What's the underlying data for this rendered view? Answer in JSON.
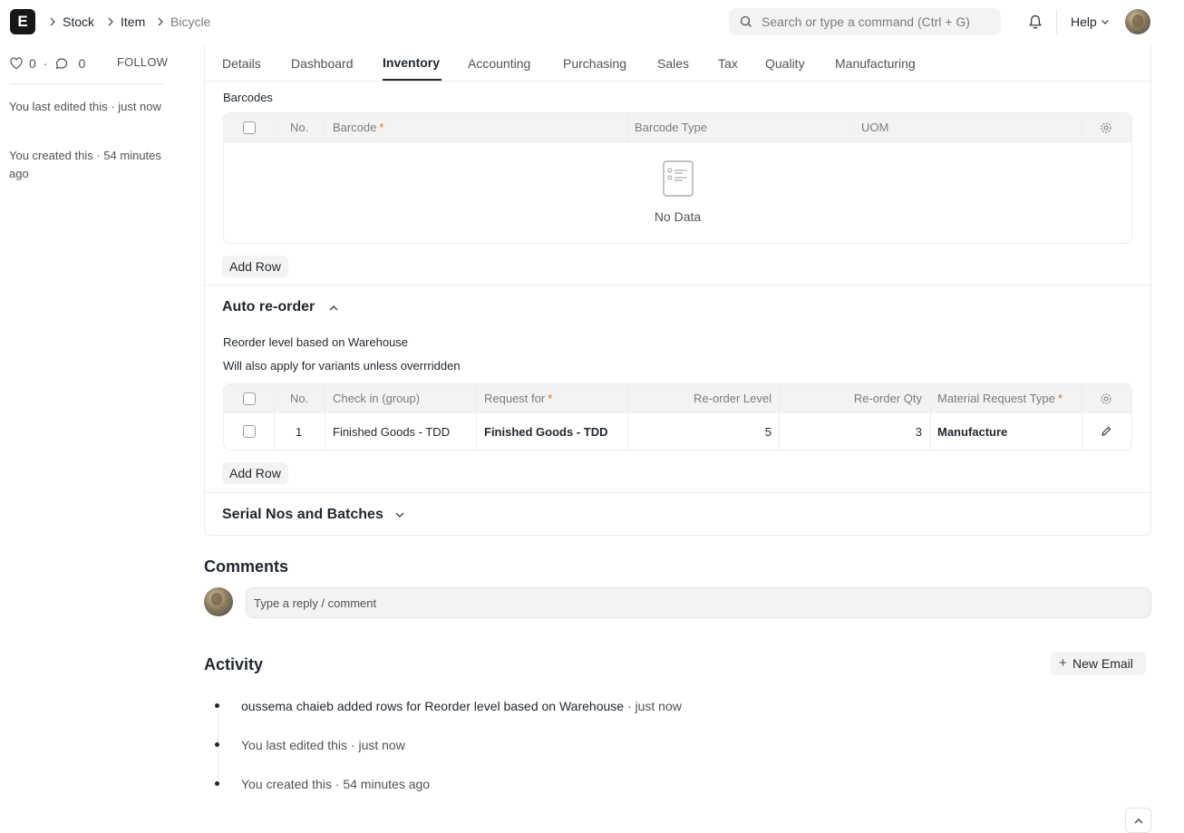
{
  "navbar": {
    "logo_letter": "E",
    "breadcrumbs": [
      "Stock",
      "Item",
      "Bicycle"
    ],
    "search_placeholder": "Search or type a command (Ctrl + G)",
    "help_label": "Help"
  },
  "sidebar": {
    "likes_count": "0",
    "comments_count": "0",
    "follow_label": "FOLLOW",
    "last_edited": "You last edited this · just now",
    "created": "You created this · 54 minutes ago"
  },
  "tabs": [
    "Details",
    "Dashboard",
    "Inventory",
    "Accounting",
    "Purchasing",
    "Sales",
    "Tax",
    "Quality",
    "Manufacturing"
  ],
  "active_tab": "Inventory",
  "barcodes": {
    "label": "Barcodes",
    "columns": {
      "no": "No.",
      "barcode": "Barcode",
      "barcode_type": "Barcode Type",
      "uom": "UOM"
    },
    "empty_text": "No Data",
    "add_row": "Add Row"
  },
  "reorder": {
    "section_title": "Auto re-order",
    "table_label": "Reorder level based on Warehouse",
    "description": "Will also apply for variants unless overrridden",
    "columns": {
      "no": "No.",
      "check_in_group": "Check in (group)",
      "request_for": "Request for",
      "reorder_level": "Re-order Level",
      "reorder_qty": "Re-order Qty",
      "material_request_type": "Material Request Type"
    },
    "rows": [
      {
        "no": "1",
        "check_in_group": "Finished Goods - TDD",
        "request_for": "Finished Goods - TDD",
        "reorder_level": "5",
        "reorder_qty": "3",
        "material_request_type": "Manufacture"
      }
    ],
    "add_row": "Add Row"
  },
  "serial_section": {
    "title": "Serial Nos and Batches"
  },
  "comments": {
    "title": "Comments",
    "placeholder": "Type a reply / comment"
  },
  "activity": {
    "title": "Activity",
    "new_email": "New Email",
    "items": [
      {
        "text": "oussema chaieb added rows for Reorder level based on Warehouse",
        "time": " · just now"
      },
      {
        "text": "You last edited this",
        "time": " · just now"
      },
      {
        "text": "You created this",
        "time": " · 54 minutes ago"
      }
    ]
  },
  "colors": {
    "required_marker": "#e86c13",
    "active_tab": "#1f272e",
    "muted_text": "#525252"
  },
  "icons": [
    "search-icon",
    "bell-icon",
    "chevron-down-icon",
    "heart-icon",
    "comment-icon",
    "gear-icon",
    "edit-icon",
    "chevron-up-icon",
    "document-list-icon"
  ]
}
